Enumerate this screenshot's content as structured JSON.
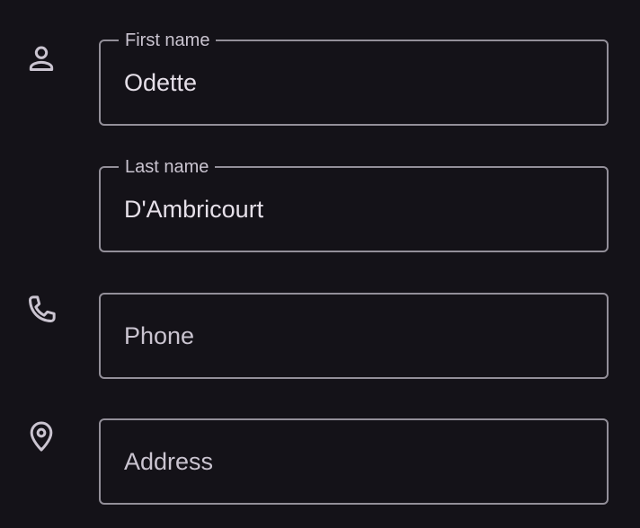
{
  "form": {
    "first_name": {
      "label": "First name",
      "value": "Odette"
    },
    "last_name": {
      "label": "Last name",
      "value": "D'Ambricourt"
    },
    "phone": {
      "placeholder": "Phone",
      "value": ""
    },
    "address": {
      "placeholder": "Address",
      "value": ""
    }
  },
  "icons": {
    "person": "person-icon",
    "phone": "phone-icon",
    "location": "location-icon"
  },
  "colors": {
    "background": "#141218",
    "outline": "#938f99",
    "text": "#e6e0e9",
    "label": "#cac4d0",
    "icon": "#cac4d0"
  }
}
